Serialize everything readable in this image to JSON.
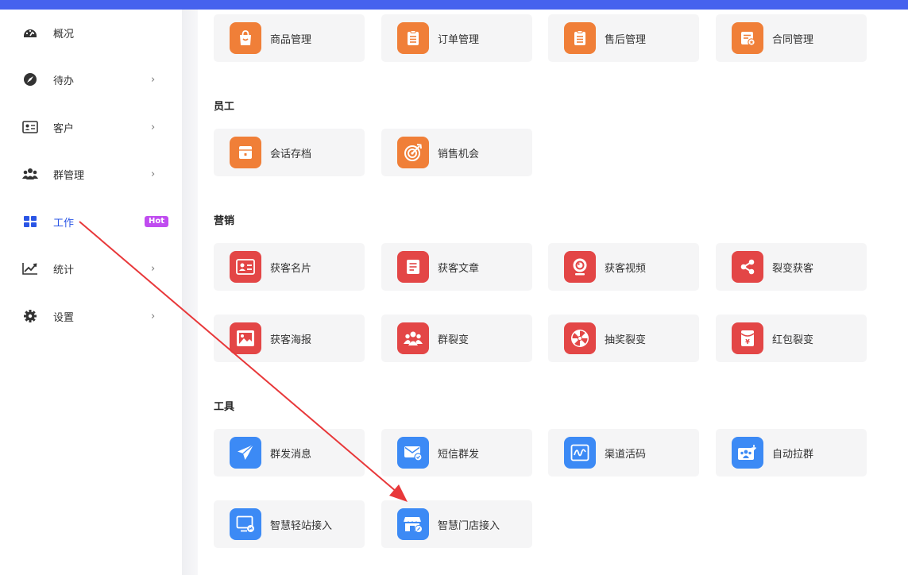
{
  "sidebar": {
    "items": [
      {
        "label": "概况",
        "icon": "dashboard-gauge-icon",
        "chevron": false
      },
      {
        "label": "待办",
        "icon": "compass-icon",
        "chevron": true
      },
      {
        "label": "客户",
        "icon": "contact-card-icon",
        "chevron": true
      },
      {
        "label": "群管理",
        "icon": "group-people-icon",
        "chevron": true
      },
      {
        "label": "工作",
        "icon": "grid-apps-icon",
        "chevron": false,
        "badge": "Hot",
        "active": true
      },
      {
        "label": "统计",
        "icon": "line-chart-icon",
        "chevron": true
      },
      {
        "label": "设置",
        "icon": "gear-icon",
        "chevron": true
      }
    ]
  },
  "sections": {
    "staff": "员工",
    "marketing": "营销",
    "tools": "工具"
  },
  "cards": {
    "goods": "商品管理",
    "orders": "订单管理",
    "aftersale": "售后管理",
    "contract": "合同管理",
    "chat_archive": "会话存档",
    "sales_opportunity": "销售机会",
    "card": "获客名片",
    "article": "获客文章",
    "video": "获客视频",
    "fission": "裂变获客",
    "poster": "获客海报",
    "group_fission": "群裂变",
    "lottery": "抽奖裂变",
    "redpacket": "红包裂变",
    "mass_msg": "群发消息",
    "sms": "短信群发",
    "channel_code": "渠道活码",
    "auto_group": "自动拉群",
    "smart_site": "智慧轻站接入",
    "smart_store": "智慧门店接入"
  },
  "colors": {
    "topbar": "#4662ee",
    "active": "#2a55e5",
    "hot_badge": "#c04cf0",
    "orange": "#f07f38",
    "red": "#e34646",
    "blue": "#3c8af5",
    "annotation_arrow": "#e8383a"
  }
}
